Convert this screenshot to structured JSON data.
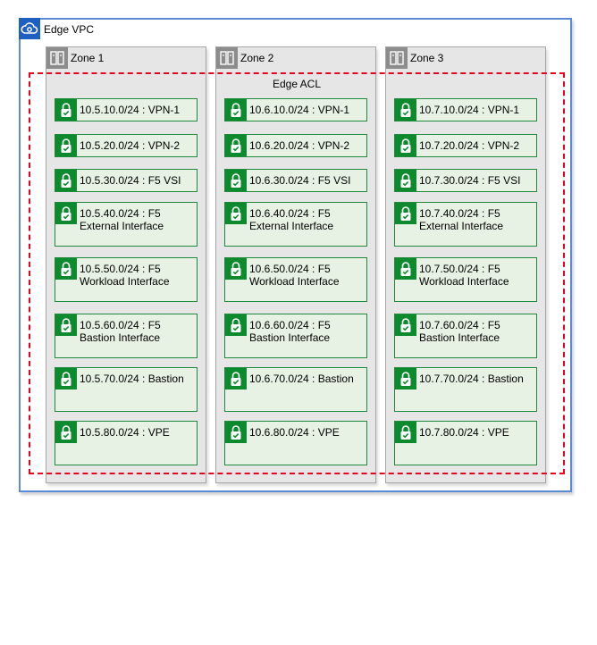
{
  "vpc": {
    "title": "Edge VPC",
    "icon": "cloud-vpc-icon"
  },
  "acl": {
    "title": "Edge ACL",
    "border_color": "#e8001c"
  },
  "colors": {
    "vpc_border": "#5b8bd6",
    "zone_fill": "#e6e6e6",
    "subnet_fill": "#e7f2e4",
    "subnet_border": "#1f8a3b",
    "lock_icon": "#0e8a2e"
  },
  "zones": [
    {
      "title": "Zone 1",
      "icon": "zone-building-icon",
      "subnets": [
        {
          "label": "10.5.10.0/24 : VPN-1"
        },
        {
          "label": "10.5.20.0/24 : VPN-2"
        },
        {
          "label": "10.5.30.0/24 : F5 VSI"
        },
        {
          "label": "10.5.40.0/24 : F5 External Interface"
        },
        {
          "label": "10.5.50.0/24 : F5 Workload Interface"
        },
        {
          "label": "10.5.60.0/24 : F5 Bastion Interface"
        },
        {
          "label": "10.5.70.0/24 : Bastion"
        },
        {
          "label": "10.5.80.0/24 : VPE"
        }
      ]
    },
    {
      "title": "Zone 2",
      "icon": "zone-building-icon",
      "subnets": [
        {
          "label": "10.6.10.0/24 : VPN-1"
        },
        {
          "label": "10.6.20.0/24 : VPN-2"
        },
        {
          "label": "10.6.30.0/24 : F5 VSI"
        },
        {
          "label": "10.6.40.0/24 : F5 External Interface"
        },
        {
          "label": "10.6.50.0/24 : F5 Workload Interface"
        },
        {
          "label": "10.6.60.0/24 : F5 Bastion Interface"
        },
        {
          "label": "10.6.70.0/24 : Bastion"
        },
        {
          "label": "10.6.80.0/24 : VPE"
        }
      ]
    },
    {
      "title": "Zone 3",
      "icon": "zone-building-icon",
      "subnets": [
        {
          "label": "10.7.10.0/24 : VPN-1"
        },
        {
          "label": "10.7.20.0/24 : VPN-2"
        },
        {
          "label": "10.7.30.0/24 : F5 VSI"
        },
        {
          "label": "10.7.40.0/24 : F5 External Interface"
        },
        {
          "label": "10.7.50.0/24 : F5 Workload Interface"
        },
        {
          "label": "10.7.60.0/24 : F5 Bastion Interface"
        },
        {
          "label": "10.7.70.0/24 : Bastion"
        },
        {
          "label": "10.7.80.0/24 : VPE"
        }
      ]
    }
  ]
}
